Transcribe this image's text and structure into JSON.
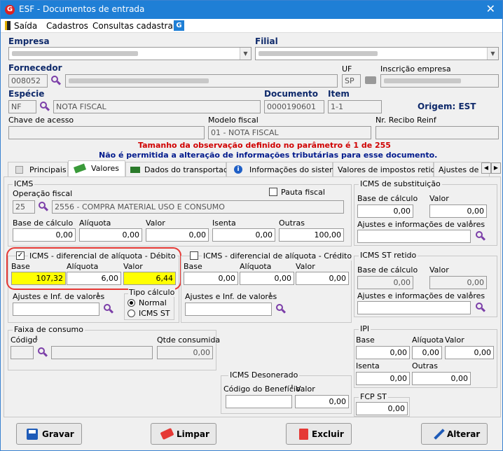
{
  "window": {
    "title": "ESF - Documentos de entrada",
    "close_icon": "close-icon"
  },
  "menu": {
    "items": [
      "Saída",
      "Cadastros",
      "Consultas cadastrais"
    ]
  },
  "header": {
    "empresa_label": "Empresa",
    "filial_label": "Filial",
    "fornecedor_label": "Fornecedor",
    "fornecedor_code": "008052",
    "uf_label": "UF",
    "uf_value": "SP",
    "inscricao_label": "Inscrição empresa",
    "especie_label": "Espécie",
    "especie_code": "NF",
    "especie_desc": "NOTA FISCAL",
    "documento_label": "Documento",
    "documento_value": "0000190601",
    "item_label": "Item",
    "item_value": "1-1",
    "origem": "Origem: EST",
    "chave_label": "Chave de acesso",
    "modelo_label": "Modelo fiscal",
    "modelo_value": "01 - NOTA FISCAL",
    "recibo_label": "Nr. Recibo Reinf"
  },
  "messages": {
    "line1": "Tamanho da observação definido no parâmetro é 1 de 255",
    "line2": "Não é permitida a alteração de informações tributárias para esse documento."
  },
  "tabs": [
    "Principais",
    "Valores",
    "Dados do transportador",
    "Informações do sistema",
    "Valores de impostos retidos",
    "Ajustes de C"
  ],
  "icms": {
    "title": "ICMS",
    "operacao_label": "Operação fiscal",
    "operacao_code": "25",
    "operacao_desc": "2556 - COMPRA MATERIAL USO E CONSUMO",
    "pauta_label": "Pauta fiscal",
    "base_label": "Base de cálculo",
    "base": "0,00",
    "aliquota_label": "Alíquota",
    "aliquota": "0,00",
    "valor_label": "Valor",
    "valor": "0,00",
    "isenta_label": "Isenta",
    "isenta": "0,00",
    "outras_label": "Outras",
    "outras": "100,00"
  },
  "icms_st": {
    "title": "ICMS de substituição",
    "base_label": "Base de cálculo",
    "base": "0,00",
    "valor_label": "Valor",
    "valor": "0,00",
    "ajustes_label": "Ajustes e informações de valores"
  },
  "difal_debito": {
    "title": "ICMS - diferencial de alíquota - Débito",
    "base_label": "Base",
    "base": "107,32",
    "aliquota_label": "Alíquota",
    "aliquota": "6,00",
    "valor_label": "Valor",
    "valor": "6,44",
    "ajustes_label": "Ajustes e Inf. de valores",
    "tipo_label": "Tipo cálculo",
    "opt_normal": "Normal",
    "opt_st": "ICMS ST"
  },
  "difal_credito": {
    "title": "ICMS - diferencial de alíquota - Crédito",
    "base_label": "Base",
    "base": "0,00",
    "aliquota_label": "Alíquota",
    "aliquota": "0,00",
    "valor_label": "Valor",
    "valor": "0,00",
    "ajustes_label": "Ajustes e Inf. de valores"
  },
  "icms_st_retido": {
    "title": "ICMS ST retido",
    "base_label": "Base de cálculo",
    "base": "0,00",
    "valor_label": "Valor",
    "valor": "0,00",
    "ajustes_label": "Ajustes e informações de valores"
  },
  "faixa": {
    "title": "Faixa de consumo",
    "codigo_label": "Código",
    "qtde_label": "Qtde consumida",
    "qtde": "0,00"
  },
  "ipi": {
    "title": "IPI",
    "base_label": "Base",
    "base": "0,00",
    "aliquota_label": "Alíquota",
    "aliquota": "0,00",
    "valor_label": "Valor",
    "valor": "0,00",
    "isenta_label": "Isenta",
    "isenta": "0,00",
    "outras_label": "Outras",
    "outras": "0,00"
  },
  "desonerado": {
    "title": "ICMS Desonerado",
    "codigo_label": "Código do Benefício",
    "valor_label": "Valor",
    "valor": "0,00"
  },
  "fcp_st": {
    "title": "FCP ST",
    "valor": "0,00"
  },
  "buttons": {
    "gravar": "Gravar",
    "limpar": "Limpar",
    "excluir": "Excluir",
    "alterar": "Alterar"
  },
  "colors": {
    "title_bar": "#1f7fd6",
    "highlight": "#ffff00",
    "circle": "#e53935",
    "labels": "#0f2a6b",
    "message_red": "#d00000",
    "message_blue": "#001a8c"
  }
}
